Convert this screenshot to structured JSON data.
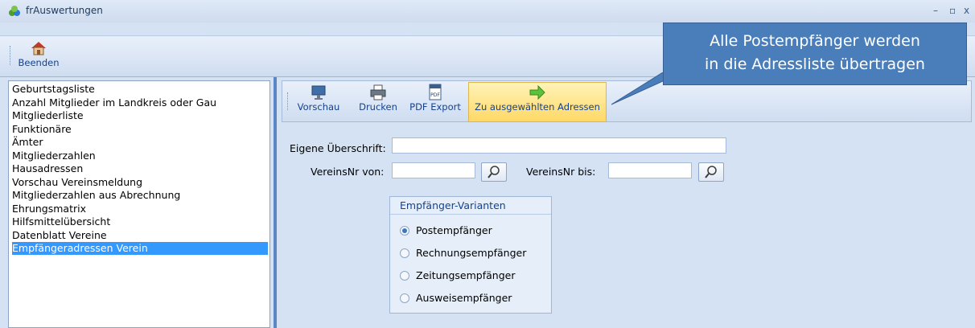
{
  "window": {
    "title": "frAuswertungen"
  },
  "ribbon": {
    "exit_label": "Beenden"
  },
  "report_list": {
    "items": [
      "Geburtstagsliste",
      "Anzahl Mitglieder im Landkreis oder Gau",
      "Mitgliederliste",
      "Funktionäre",
      "Ämter",
      "Mitgliederzahlen",
      "Hausadressen",
      "Vorschau Vereinsmeldung",
      "Mitgliederzahlen aus Abrechnung",
      "Ehrungsmatrix",
      "Hilfsmittelübersicht",
      "Datenblatt Vereine",
      "Empfängeradressen Verein"
    ],
    "selected_index": 12
  },
  "toolbar": {
    "preview_label": "Vorschau",
    "print_label": "Drucken",
    "pdf_label": "PDF Export",
    "transfer_label": "Zu ausgewählten Adressen",
    "pdf_icon_text": "PDF"
  },
  "form": {
    "heading_label": "Eigene Überschrift:",
    "heading_value": "",
    "club_from_label": "VereinsNr von:",
    "club_from_value": "",
    "club_to_label": "VereinsNr bis:",
    "club_to_value": ""
  },
  "recipients": {
    "title": "Empfänger-Varianten",
    "options": [
      "Postempfänger",
      "Rechnungsempfänger",
      "Zeitungsempfänger",
      "Ausweisempfänger"
    ],
    "selected_index": 0
  },
  "callout": {
    "line1": "Alle Postempfänger werden",
    "line2": "in die Adressliste übertragen"
  },
  "colors": {
    "accent": "#3399ff",
    "callout": "#4a7ebb",
    "highlight": "#ffd867"
  }
}
